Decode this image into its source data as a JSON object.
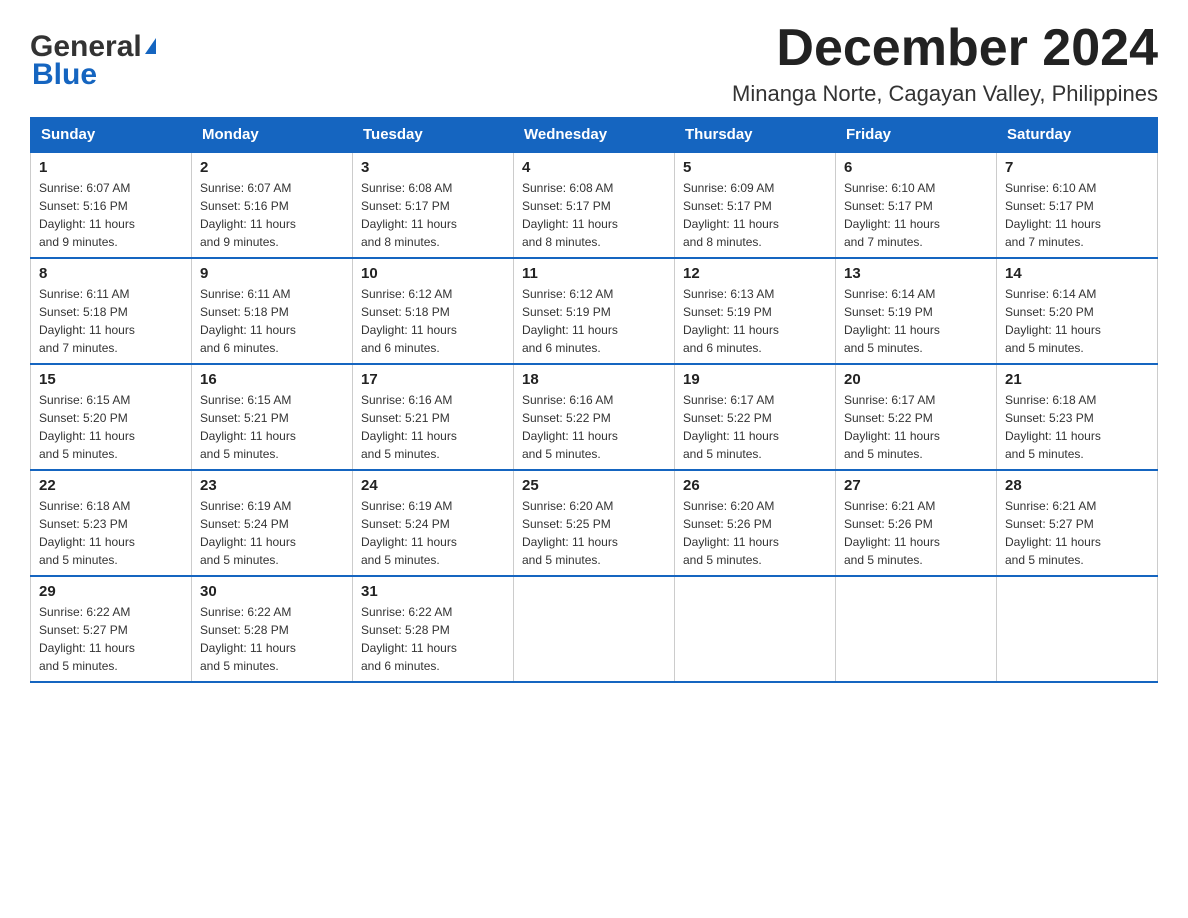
{
  "header": {
    "logo_general": "General",
    "logo_blue": "Blue",
    "main_title": "December 2024",
    "subtitle": "Minanga Norte, Cagayan Valley, Philippines"
  },
  "days_of_week": [
    "Sunday",
    "Monday",
    "Tuesday",
    "Wednesday",
    "Thursday",
    "Friday",
    "Saturday"
  ],
  "weeks": [
    [
      {
        "day": "1",
        "sunrise": "6:07 AM",
        "sunset": "5:16 PM",
        "daylight": "11 hours and 9 minutes."
      },
      {
        "day": "2",
        "sunrise": "6:07 AM",
        "sunset": "5:16 PM",
        "daylight": "11 hours and 9 minutes."
      },
      {
        "day": "3",
        "sunrise": "6:08 AM",
        "sunset": "5:17 PM",
        "daylight": "11 hours and 8 minutes."
      },
      {
        "day": "4",
        "sunrise": "6:08 AM",
        "sunset": "5:17 PM",
        "daylight": "11 hours and 8 minutes."
      },
      {
        "day": "5",
        "sunrise": "6:09 AM",
        "sunset": "5:17 PM",
        "daylight": "11 hours and 8 minutes."
      },
      {
        "day": "6",
        "sunrise": "6:10 AM",
        "sunset": "5:17 PM",
        "daylight": "11 hours and 7 minutes."
      },
      {
        "day": "7",
        "sunrise": "6:10 AM",
        "sunset": "5:17 PM",
        "daylight": "11 hours and 7 minutes."
      }
    ],
    [
      {
        "day": "8",
        "sunrise": "6:11 AM",
        "sunset": "5:18 PM",
        "daylight": "11 hours and 7 minutes."
      },
      {
        "day": "9",
        "sunrise": "6:11 AM",
        "sunset": "5:18 PM",
        "daylight": "11 hours and 6 minutes."
      },
      {
        "day": "10",
        "sunrise": "6:12 AM",
        "sunset": "5:18 PM",
        "daylight": "11 hours and 6 minutes."
      },
      {
        "day": "11",
        "sunrise": "6:12 AM",
        "sunset": "5:19 PM",
        "daylight": "11 hours and 6 minutes."
      },
      {
        "day": "12",
        "sunrise": "6:13 AM",
        "sunset": "5:19 PM",
        "daylight": "11 hours and 6 minutes."
      },
      {
        "day": "13",
        "sunrise": "6:14 AM",
        "sunset": "5:19 PM",
        "daylight": "11 hours and 5 minutes."
      },
      {
        "day": "14",
        "sunrise": "6:14 AM",
        "sunset": "5:20 PM",
        "daylight": "11 hours and 5 minutes."
      }
    ],
    [
      {
        "day": "15",
        "sunrise": "6:15 AM",
        "sunset": "5:20 PM",
        "daylight": "11 hours and 5 minutes."
      },
      {
        "day": "16",
        "sunrise": "6:15 AM",
        "sunset": "5:21 PM",
        "daylight": "11 hours and 5 minutes."
      },
      {
        "day": "17",
        "sunrise": "6:16 AM",
        "sunset": "5:21 PM",
        "daylight": "11 hours and 5 minutes."
      },
      {
        "day": "18",
        "sunrise": "6:16 AM",
        "sunset": "5:22 PM",
        "daylight": "11 hours and 5 minutes."
      },
      {
        "day": "19",
        "sunrise": "6:17 AM",
        "sunset": "5:22 PM",
        "daylight": "11 hours and 5 minutes."
      },
      {
        "day": "20",
        "sunrise": "6:17 AM",
        "sunset": "5:22 PM",
        "daylight": "11 hours and 5 minutes."
      },
      {
        "day": "21",
        "sunrise": "6:18 AM",
        "sunset": "5:23 PM",
        "daylight": "11 hours and 5 minutes."
      }
    ],
    [
      {
        "day": "22",
        "sunrise": "6:18 AM",
        "sunset": "5:23 PM",
        "daylight": "11 hours and 5 minutes."
      },
      {
        "day": "23",
        "sunrise": "6:19 AM",
        "sunset": "5:24 PM",
        "daylight": "11 hours and 5 minutes."
      },
      {
        "day": "24",
        "sunrise": "6:19 AM",
        "sunset": "5:24 PM",
        "daylight": "11 hours and 5 minutes."
      },
      {
        "day": "25",
        "sunrise": "6:20 AM",
        "sunset": "5:25 PM",
        "daylight": "11 hours and 5 minutes."
      },
      {
        "day": "26",
        "sunrise": "6:20 AM",
        "sunset": "5:26 PM",
        "daylight": "11 hours and 5 minutes."
      },
      {
        "day": "27",
        "sunrise": "6:21 AM",
        "sunset": "5:26 PM",
        "daylight": "11 hours and 5 minutes."
      },
      {
        "day": "28",
        "sunrise": "6:21 AM",
        "sunset": "5:27 PM",
        "daylight": "11 hours and 5 minutes."
      }
    ],
    [
      {
        "day": "29",
        "sunrise": "6:22 AM",
        "sunset": "5:27 PM",
        "daylight": "11 hours and 5 minutes."
      },
      {
        "day": "30",
        "sunrise": "6:22 AM",
        "sunset": "5:28 PM",
        "daylight": "11 hours and 5 minutes."
      },
      {
        "day": "31",
        "sunrise": "6:22 AM",
        "sunset": "5:28 PM",
        "daylight": "11 hours and 6 minutes."
      },
      null,
      null,
      null,
      null
    ]
  ],
  "labels": {
    "sunrise": "Sunrise:",
    "sunset": "Sunset:",
    "daylight": "Daylight:"
  }
}
